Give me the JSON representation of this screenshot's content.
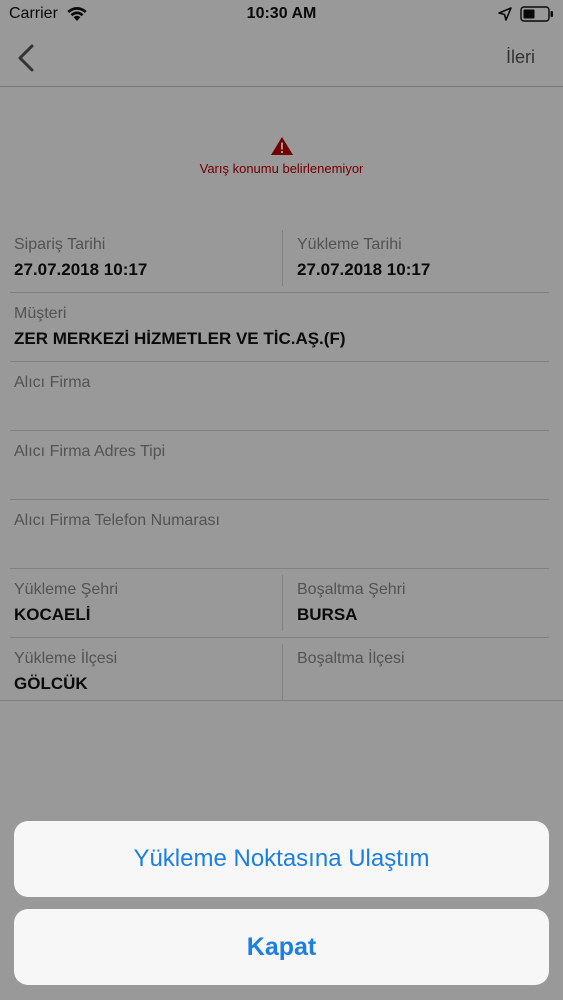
{
  "status_bar": {
    "carrier": "Carrier",
    "time": "10:30 AM"
  },
  "nav": {
    "next_label": "İleri"
  },
  "warning": {
    "text": "Varış konumu belirlenemiyor",
    "color": "#c00000"
  },
  "form": {
    "order_date": {
      "label": "Sipariş Tarihi",
      "value": "27.07.2018 10:17"
    },
    "loading_date": {
      "label": "Yükleme Tarihi",
      "value": "27.07.2018 10:17"
    },
    "customer": {
      "label": "Müşteri",
      "value": "ZER MERKEZİ HİZMETLER VE TİC.AŞ.(F)"
    },
    "receiver_company": {
      "label": "Alıcı Firma",
      "value": ""
    },
    "receiver_address_type": {
      "label": "Alıcı Firma Adres Tipi",
      "value": ""
    },
    "receiver_phone": {
      "label": "Alıcı Firma Telefon Numarası",
      "value": ""
    },
    "loading_city": {
      "label": "Yükleme Şehri",
      "value": "KOCAELİ"
    },
    "unloading_city": {
      "label": "Boşaltma Şehri",
      "value": "BURSA"
    },
    "loading_district": {
      "label": "Yükleme İlçesi",
      "value": "GÖLCÜK"
    },
    "unloading_district": {
      "label": "Boşaltma İlçesi",
      "value": ""
    }
  },
  "action_sheet": {
    "primary_label": "Yükleme Noktasına Ulaştım",
    "cancel_label": "Kapat",
    "accent_color": "#1d7fe0"
  },
  "icons": {
    "back": "chevron-left-icon",
    "warning": "warning-triangle-icon",
    "wifi": "wifi-icon",
    "location": "location-arrow-icon",
    "battery": "battery-icon"
  }
}
